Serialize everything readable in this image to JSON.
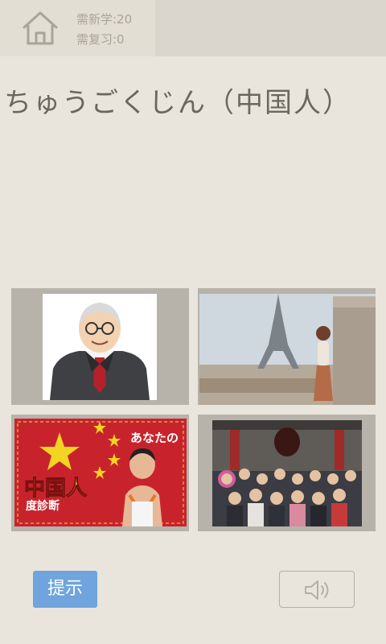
{
  "header": {
    "home_icon": "home-icon",
    "new_count": "需新学:20",
    "review_count": "需复习:0"
  },
  "word": {
    "text": "ちゅうごくじん（中国人）"
  },
  "options": [
    {
      "image": "old-man-in-suit-illustration"
    },
    {
      "image": "woman-in-front-of-eiffel-tower"
    },
    {
      "image": "chinese-flag-with-boy",
      "caption_top": "あなたの",
      "caption_main": "中国人",
      "caption_sub": "度診断"
    },
    {
      "image": "group-of-tourists-at-temple-gate"
    }
  ],
  "footer": {
    "hint_label": "提示",
    "sound_icon": "speaker-icon"
  },
  "colors": {
    "background": "#e9e5dc",
    "hint_button": "#6fa4dc",
    "text": "#6b6760"
  }
}
